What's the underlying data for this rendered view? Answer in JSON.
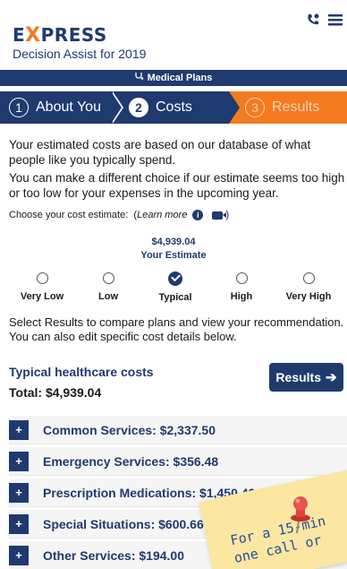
{
  "header": {
    "logo_pre": "E",
    "logo_x": "X",
    "logo_post": "PRESS",
    "subtitle": "Decision Assist for 2019",
    "icons": [
      "phone-icon",
      "menu-icon"
    ]
  },
  "plans_bar": {
    "label": "Medical Plans",
    "icon": "stethoscope-icon"
  },
  "steps": [
    {
      "num": "1",
      "label": "About You"
    },
    {
      "num": "2",
      "label": "Costs"
    },
    {
      "num": "3",
      "label": "Results"
    }
  ],
  "intro": {
    "p1": "Your estimated costs are based on our database of what people like you typically spend.",
    "p2": "You can make a different choice if our estimate seems too high or too low for your expenses in the upcoming year."
  },
  "choose": {
    "label": "Choose your cost estimate:",
    "learn_more": "Learn more"
  },
  "estimate": {
    "amount": "$4,939.04",
    "label": "Your Estimate"
  },
  "scale": {
    "options": [
      "Very Low",
      "Low",
      "Typical",
      "High",
      "Very High"
    ],
    "selected": "Typical"
  },
  "note": "Select Results to compare plans and view your recommendation. You can also edit specific cost details below.",
  "healthcare": {
    "title": "Typical healthcare costs",
    "total": "Total: $4,939.04",
    "results_label": "Results"
  },
  "sections": [
    {
      "label": "Common Services: $2,337.50"
    },
    {
      "label": "Emergency Services: $356.48"
    },
    {
      "label": "Prescription Medications: $1,450.40"
    },
    {
      "label": "Special Situations: $600.66"
    },
    {
      "label": "Other Services: $194.00"
    }
  ],
  "sticky_note": {
    "line1": "For a 15-min",
    "line2": "one call or"
  },
  "colors": {
    "navy": "#1f3a6e",
    "orange": "#f47a20",
    "sticky": "#fbe7a1"
  }
}
